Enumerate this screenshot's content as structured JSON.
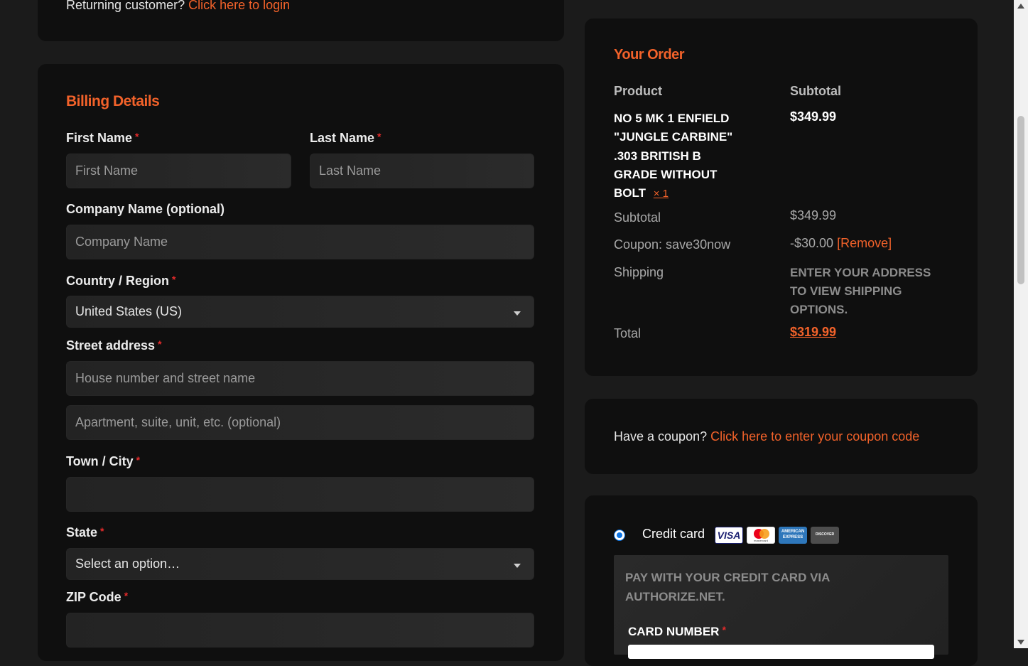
{
  "returning": {
    "text": "Returning customer?",
    "link": "Click here to login"
  },
  "billing": {
    "title": "Billing Details",
    "first_name": {
      "label": "First Name",
      "placeholder": "First Name"
    },
    "last_name": {
      "label": "Last Name",
      "placeholder": "Last Name"
    },
    "company": {
      "label": "Company Name (optional)",
      "placeholder": "Company Name"
    },
    "country": {
      "label": "Country / Region",
      "value": "United States (US)"
    },
    "street": {
      "label": "Street address",
      "placeholder1": "House number and street name",
      "placeholder2": "Apartment, suite, unit, etc. (optional)"
    },
    "city": {
      "label": "Town / City",
      "value": ""
    },
    "state": {
      "label": "State",
      "value": "Select an option…"
    },
    "zip": {
      "label": "ZIP Code",
      "value": ""
    },
    "required_mark": "*"
  },
  "order": {
    "title": "Your Order",
    "col_product": "Product",
    "col_subtotal": "Subtotal",
    "item_lines": [
      "NO 5 MK 1 ENFIELD",
      "\"JUNGLE CARBINE\"",
      ".303 BRITISH B",
      "GRADE WITHOUT",
      "BOLT"
    ],
    "item_qty": "× 1",
    "item_price": "$349.99",
    "subtotal_label": "Subtotal",
    "subtotal_value": "$349.99",
    "coupon_label": "Coupon: save30now",
    "coupon_value": "-$30.00",
    "coupon_remove": "[Remove]",
    "shipping_label": "Shipping",
    "shipping_lines": [
      "ENTER YOUR ADDRESS",
      "TO VIEW SHIPPING",
      "OPTIONS."
    ],
    "total_label": "Total",
    "total_value": "$319.99"
  },
  "coupon": {
    "text": "Have a coupon?",
    "link": "Click here to enter your coupon code"
  },
  "payment": {
    "method_label": "Credit card",
    "card_logos": [
      "VISA",
      "mastercard",
      "AMERICAN EXPRESS",
      "DISCOVER"
    ],
    "desc_lines": [
      "PAY WITH YOUR CREDIT CARD VIA",
      "AUTHORIZE.NET."
    ],
    "card_number_label": "CARD NUMBER"
  },
  "colors": {
    "accent": "#f2622a",
    "required": "#e52b2b",
    "panel": "#0f0f0f",
    "background": "#1b1b1b"
  }
}
